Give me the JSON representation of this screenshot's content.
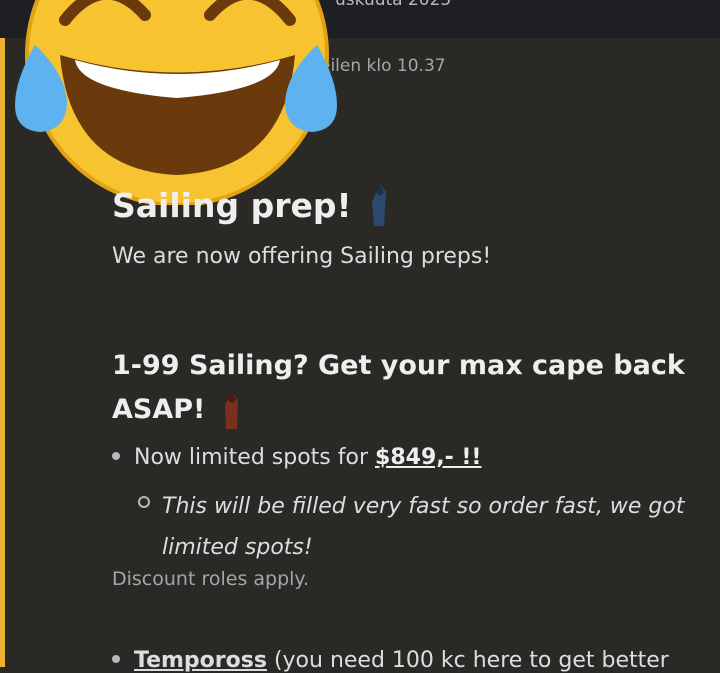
{
  "header": {
    "date_fragment": "uskuuta 2025"
  },
  "message": {
    "timestamp_fragment": "eilen klo 10.37",
    "heading": "Sailing prep!",
    "intro": "We are now offering Sailing preps!",
    "subheading": "1-99 Sailing? Get your max cape back ASAP!",
    "bullet1_text": "Now limited spots for ",
    "bullet1_price": "$849,- !!",
    "sub_bullet": "This will be filled very fast so order fast, we got limited spots!",
    "discount_note": "Discount roles apply.",
    "bullet2_bold": "Tempoross",
    "bullet2_text": " (you need 100 kc here to get better"
  },
  "colors": {
    "accent": "#f0b232",
    "background": "#2b2925",
    "topbar": "#1d1f23"
  },
  "icons": [
    "laughing-tears-emoji",
    "blue-robed-figure-icon",
    "red-robed-figure-icon"
  ]
}
